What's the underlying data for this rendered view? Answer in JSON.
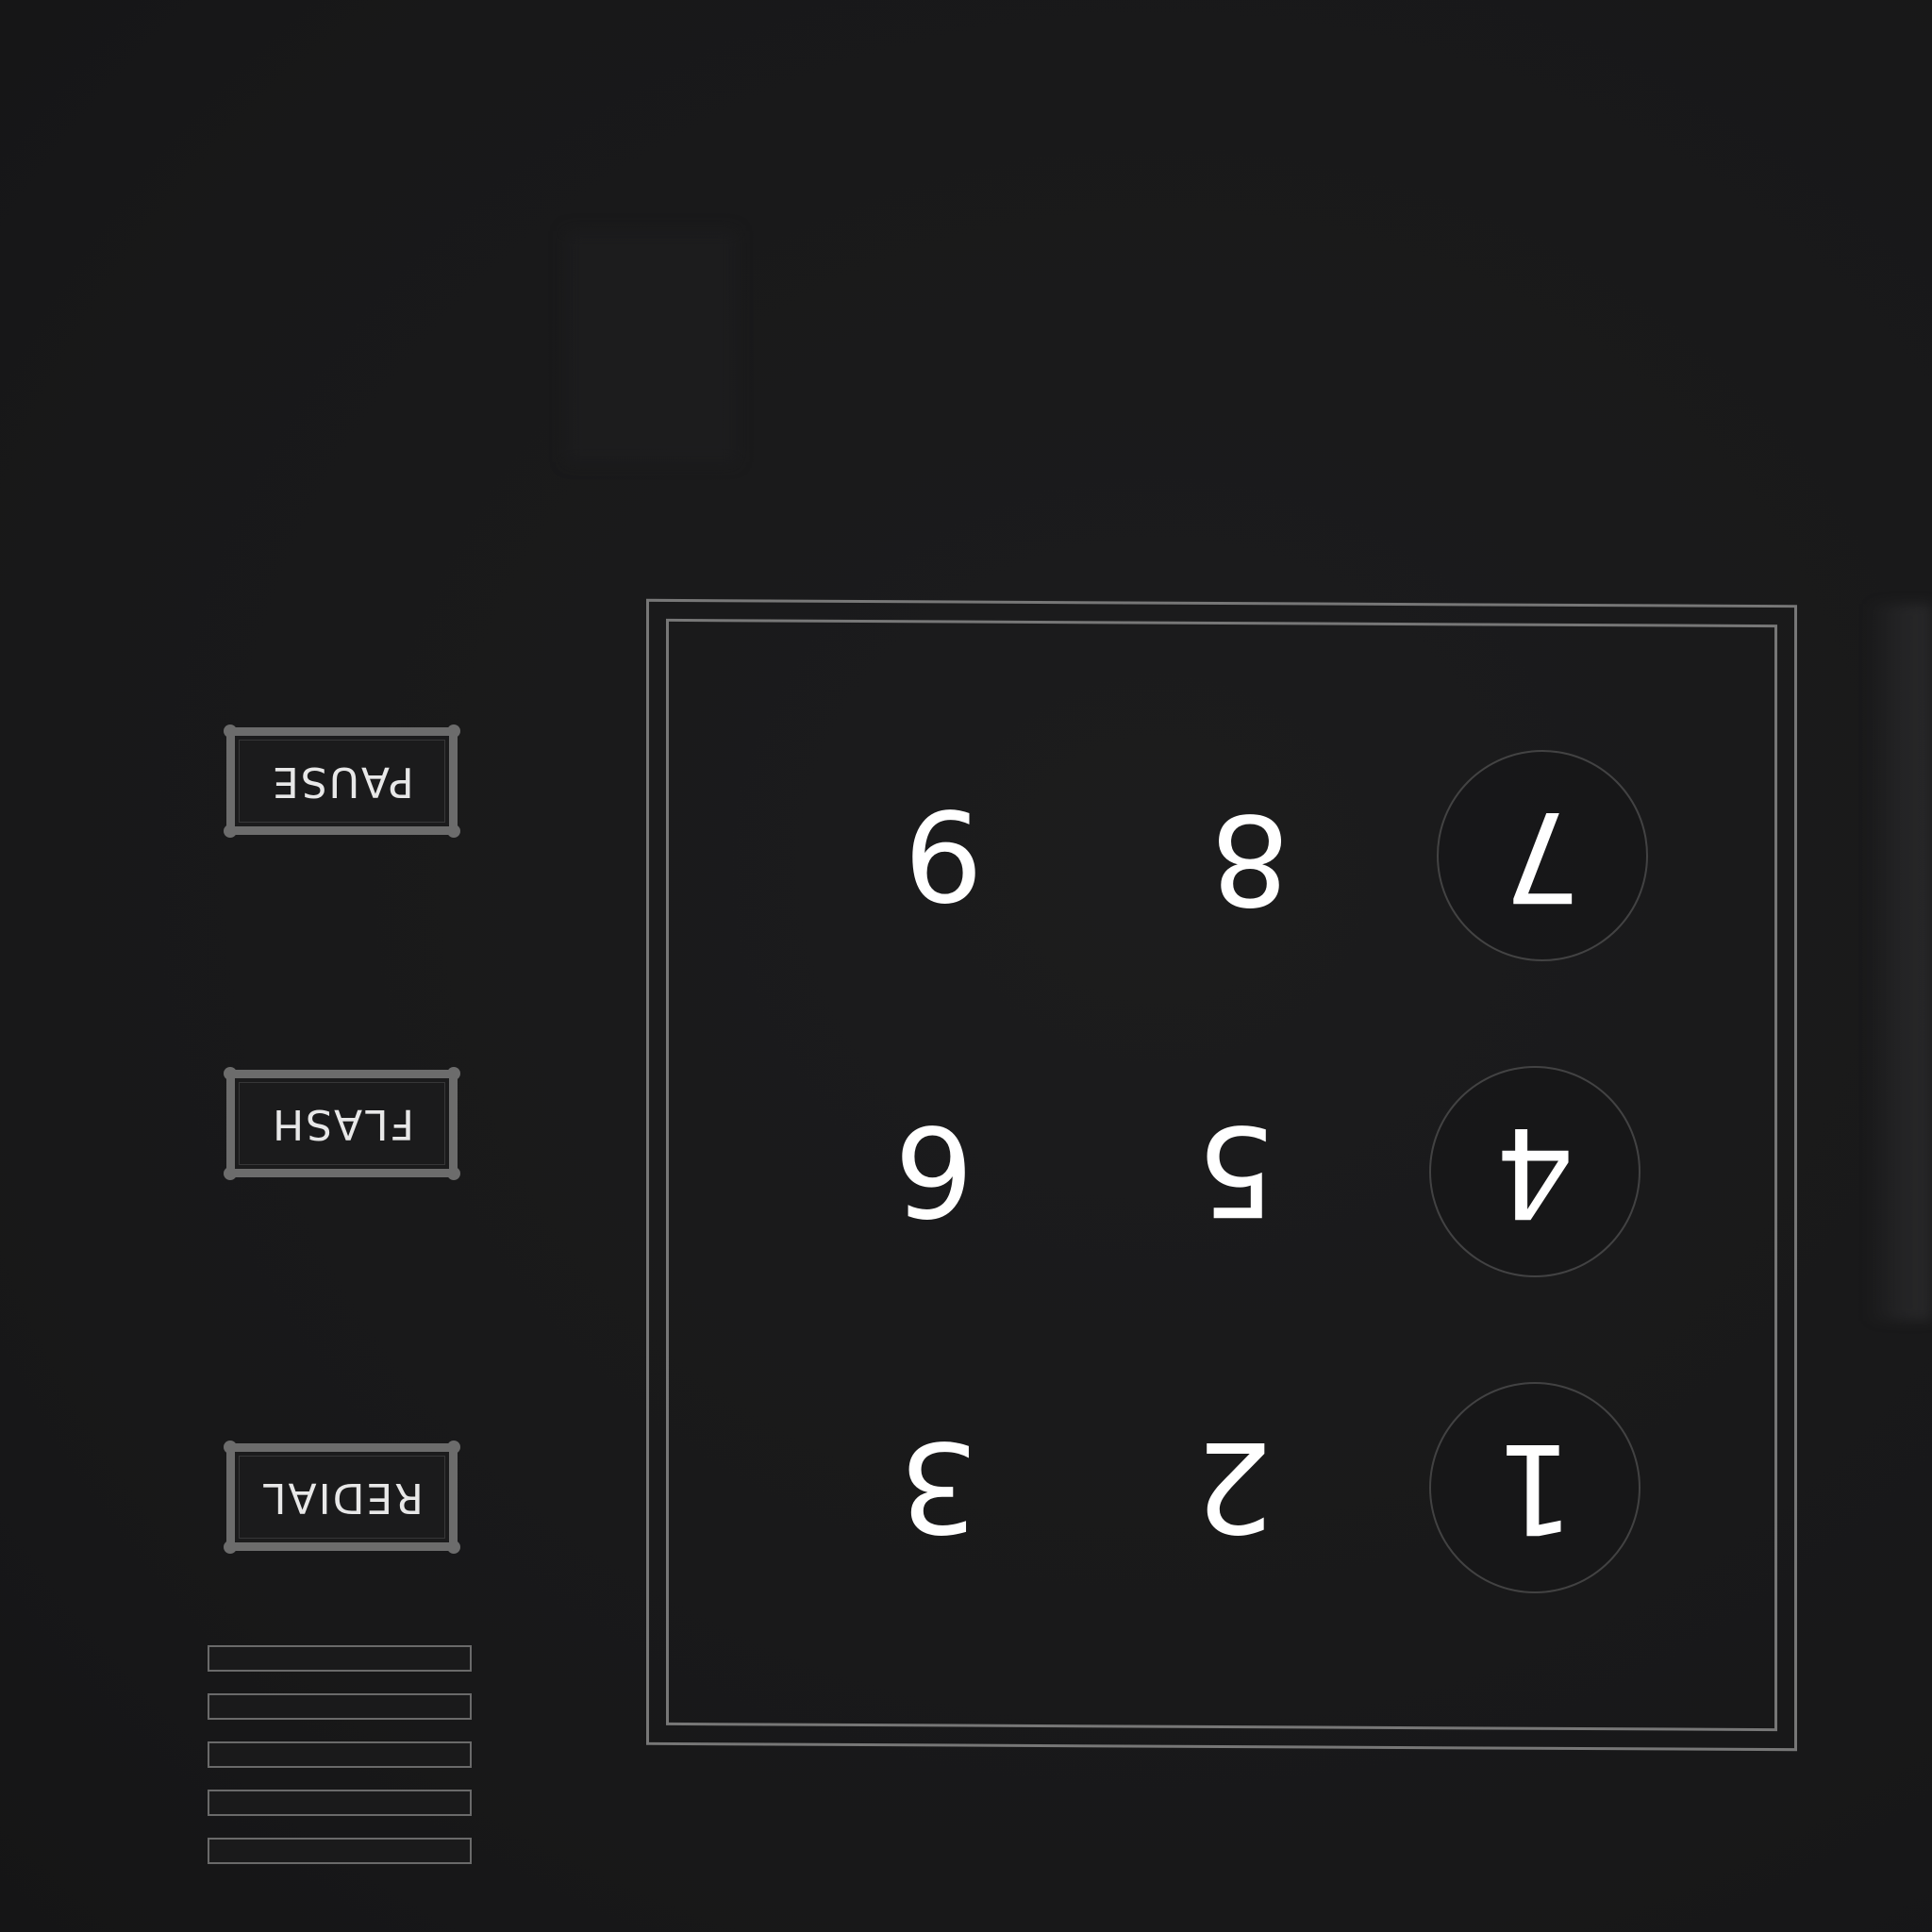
{
  "panel": {
    "side_buttons": [
      {
        "label": "PAUSE"
      },
      {
        "label": "FLASH"
      },
      {
        "label": "REDIAL"
      }
    ],
    "keys": [
      {
        "digit": "9"
      },
      {
        "digit": "8"
      },
      {
        "digit": "7"
      },
      {
        "digit": "6"
      },
      {
        "digit": "5"
      },
      {
        "digit": "4"
      },
      {
        "digit": "3"
      },
      {
        "digit": "2"
      },
      {
        "digit": "1"
      }
    ]
  },
  "colors": {
    "background": "#1a1a1b",
    "label_text": "#ffffff",
    "frame": "#777777",
    "button_border": "#6c6c6c"
  }
}
